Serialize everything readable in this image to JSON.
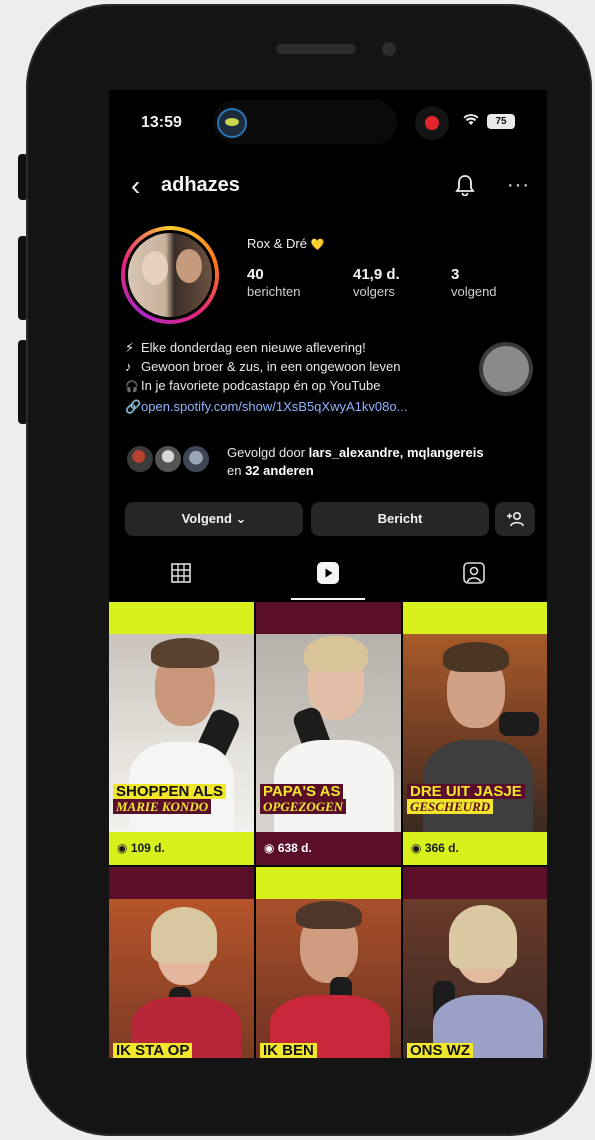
{
  "status_bar": {
    "time": "13:59",
    "battery": "75"
  },
  "header": {
    "username": "adhazes"
  },
  "profile": {
    "display_name": "Rox & Dré",
    "name_emoji": "💛",
    "stats": [
      {
        "num": "40",
        "label": "berichten"
      },
      {
        "num": "41,9 d.",
        "label": "volgers"
      },
      {
        "num": "3",
        "label": "volgend"
      }
    ],
    "bio_lines": [
      {
        "icon": "⚡",
        "text": "Elke donderdag een nieuwe aflevering!"
      },
      {
        "icon": "♪",
        "text": "Gewoon broer & zus, in een ongewoon leven"
      },
      {
        "icon": "🎧",
        "text": "In je favoriete podcastapp én op YouTube"
      }
    ],
    "link": "open.spotify.com/show/1XsB5qXwyA1kv08o...",
    "followed_by": {
      "prefix": "Gevolgd door ",
      "names": "lars_alexandre, mqlangereis",
      "line2_prefix": "en ",
      "others": "32 anderen"
    }
  },
  "buttons": {
    "following": "Volgend ⌄",
    "message": "Bericht"
  },
  "grid": {
    "tiles": [
      {
        "caption_top": "SHOPPEN ALS",
        "caption_bottom": "MARIE KONDO",
        "views": "109 d."
      },
      {
        "caption_top": "PAPA'S AS",
        "caption_bottom": "OPGEZOGEN",
        "views": "638 d."
      },
      {
        "caption_top": "DRE UIT JASJE",
        "caption_bottom": "GESCHEURD",
        "views": "366 d."
      },
      {
        "caption_top": "IK STA OP",
        "caption_bottom": "",
        "views": ""
      },
      {
        "caption_top": "IK BEN",
        "caption_bottom": "",
        "views": ""
      },
      {
        "caption_top": "ONS WZ",
        "caption_bottom": "",
        "views": ""
      }
    ]
  },
  "colors": {
    "accent_yellow": "#d8f01c",
    "maroon": "#5a0e2a",
    "link_blue": "#8fb3ff",
    "button_bg": "#262626"
  }
}
